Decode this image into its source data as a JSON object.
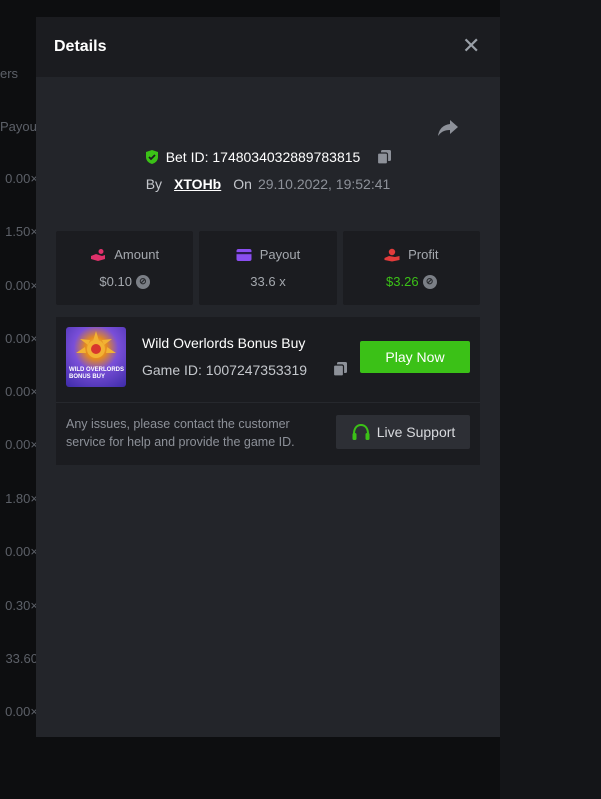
{
  "background": {
    "headers": [
      "ers",
      "Payou"
    ],
    "multipliers": [
      "0.00×",
      "1.50×",
      "0.00×",
      "0.00×",
      "0.00×",
      "0.00×",
      "1.80×",
      "0.00×",
      "0.30×",
      "33.60",
      "0.00×"
    ]
  },
  "modal": {
    "title": "Details",
    "close_icon": "✕",
    "bet_label": "Bet ID: 1748034032889783815",
    "by_label": "By",
    "username": "XTOHb",
    "on_label": "On",
    "datetime": "29.10.2022, 19:52:41",
    "stats": [
      {
        "label": "Amount",
        "value": "$0.10",
        "icon": "amount-icon",
        "color": "#e0316b"
      },
      {
        "label": "Payout",
        "value": "33.6 x",
        "icon": "card-icon",
        "color": "#8a4ef0"
      },
      {
        "label": "Profit",
        "value": "$3.26",
        "icon": "profit-icon",
        "color": "#e33b3b"
      }
    ],
    "game": {
      "title": "Wild Overlords Bonus Buy",
      "game_id": "Game ID: 1007247353319",
      "thumb_text": "WILD OVERLORDS BONUS BUY",
      "play_label": "Play Now"
    },
    "support": {
      "text": "Any issues, please contact the customer service for help and provide the game ID.",
      "button_label": "Live Support"
    }
  },
  "colors": {
    "accent_green": "#3bc117",
    "panel": "#1b1c20",
    "modal_bg": "#23252a"
  }
}
